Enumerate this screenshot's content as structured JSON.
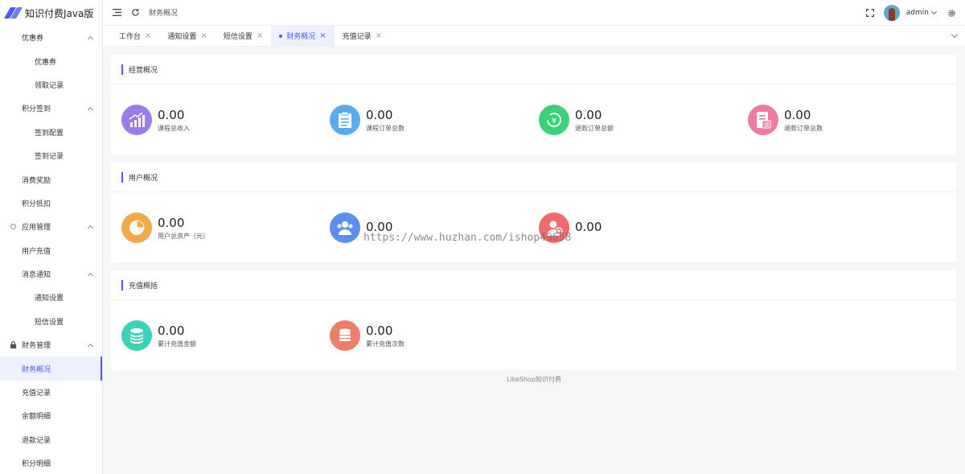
{
  "app": {
    "title": "知识付费Java版"
  },
  "sidebar": {
    "items": [
      {
        "label": "优惠券",
        "level": 1,
        "chevron": true
      },
      {
        "label": "优惠券",
        "level": 2
      },
      {
        "label": "领取记录",
        "level": 2
      },
      {
        "label": "积分签到",
        "level": 1,
        "chevron": true
      },
      {
        "label": "签到配置",
        "level": 2
      },
      {
        "label": "签到记录",
        "level": 2
      },
      {
        "label": "消费奖励",
        "level": 1
      },
      {
        "label": "积分抵扣",
        "level": 1
      },
      {
        "label": "应用管理",
        "level": 1,
        "chevron": true,
        "icon": "gear-icon"
      },
      {
        "label": "用户充值",
        "level": 1
      },
      {
        "label": "消息通知",
        "level": 1,
        "chevron": true
      },
      {
        "label": "通知设置",
        "level": 2
      },
      {
        "label": "短信设置",
        "level": 2
      },
      {
        "label": "财务管理",
        "level": 1,
        "chevron": true,
        "icon": "lock-icon"
      },
      {
        "label": "财务概况",
        "level": 1,
        "active": true
      },
      {
        "label": "充值记录",
        "level": 1
      },
      {
        "label": "余额明细",
        "level": 1
      },
      {
        "label": "退款记录",
        "level": 1
      },
      {
        "label": "积分明细",
        "level": 1
      }
    ]
  },
  "header": {
    "breadcrumb": "财务概况",
    "user": "admin"
  },
  "tabs": [
    {
      "label": "工作台",
      "close": "×"
    },
    {
      "label": "通知设置",
      "close": "×"
    },
    {
      "label": "短信设置",
      "close": "×"
    },
    {
      "label": "财务概况",
      "close": "×",
      "active": true
    },
    {
      "label": "充值记录",
      "close": "×"
    }
  ],
  "sections": [
    {
      "title": "经营概况",
      "stats": [
        {
          "value": "0.00",
          "label": "课程总收入",
          "color": "#9b7bea",
          "icon": "bar-chart-icon"
        },
        {
          "value": "0.00",
          "label": "课程订单总数",
          "color": "#5aaaf0",
          "icon": "clipboard-icon"
        },
        {
          "value": "0.00",
          "label": "退款订单总额",
          "color": "#3ccf7c",
          "icon": "refund-yen-icon"
        },
        {
          "value": "0.00",
          "label": "退款订单总数",
          "color": "#f07aa0",
          "icon": "refund-doc-icon"
        }
      ]
    },
    {
      "title": "用户概况",
      "stats": [
        {
          "value": "0.00",
          "label": "用户总资产（元）",
          "color": "#f2a94c",
          "icon": "pie-chart-icon"
        },
        {
          "value": "0.00",
          "label": "",
          "color": "#5a8ff0",
          "icon": "users-icon"
        },
        {
          "value": "0.00",
          "label": "",
          "color": "#f06a6a",
          "icon": "user-plus-icon"
        }
      ]
    },
    {
      "title": "充值概括",
      "stats": [
        {
          "value": "0.00",
          "label": "累计充值金额",
          "color": "#3ad3b8",
          "icon": "coin-stack-icon"
        },
        {
          "value": "0.00",
          "label": "累计充值次数",
          "color": "#f07d6a",
          "icon": "coins-icon"
        }
      ]
    }
  ],
  "footer": "LikeShop知识付费",
  "watermark": "https://www.huzhan.com/ishop49658"
}
